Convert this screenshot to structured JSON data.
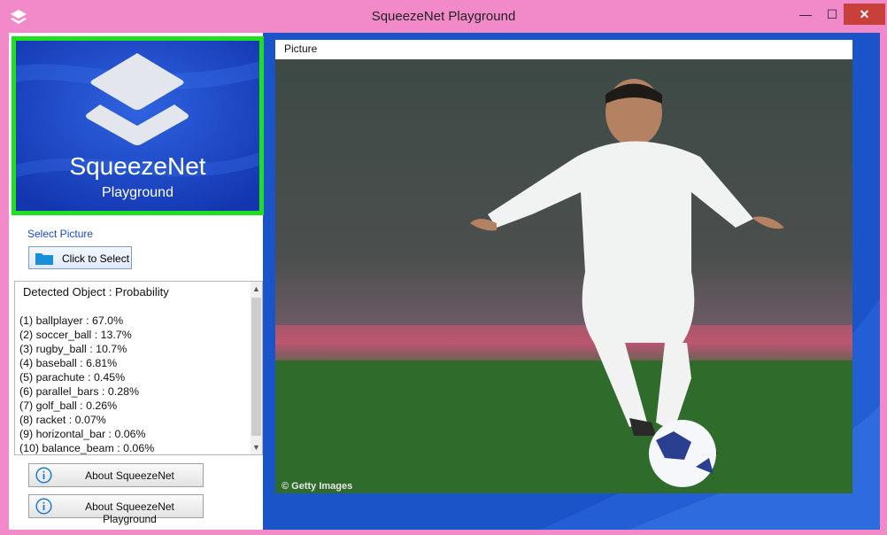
{
  "window": {
    "title": "SqueezeNet Playground",
    "controls": {
      "minimize": "—",
      "maximize": "☐",
      "close": "✕"
    }
  },
  "logo": {
    "title": "SqueezeNet",
    "subtitle": "Playground",
    "icon": "layers-icon"
  },
  "select": {
    "label": "Select Picture",
    "button_label": "Click to Select",
    "icon": "folder-icon"
  },
  "results": {
    "header": "Detected Object : Probability",
    "items": [
      "(1) ballplayer : 67.0%",
      "(2) soccer_ball : 13.7%",
      "(3) rugby_ball : 10.7%",
      "(4) baseball : 6.81%",
      "(5) parachute : 0.45%",
      "(6) parallel_bars : 0.28%",
      "(7) golf_ball : 0.26%",
      "(8) racket : 0.07%",
      "(9) horizontal_bar : 0.06%",
      "(10) balance_beam : 0.06%"
    ]
  },
  "buttons": {
    "about": "About SqueezeNet",
    "about_playground": "About SqueezeNet Playground",
    "icon": "info-icon"
  },
  "picture": {
    "label": "Picture",
    "watermark": "© Getty Images"
  },
  "colors": {
    "titlebar": "#f28ac9",
    "accent_green": "#1ee01e",
    "desktop_blue": "#1b53c9",
    "close_red": "#c7413a"
  }
}
